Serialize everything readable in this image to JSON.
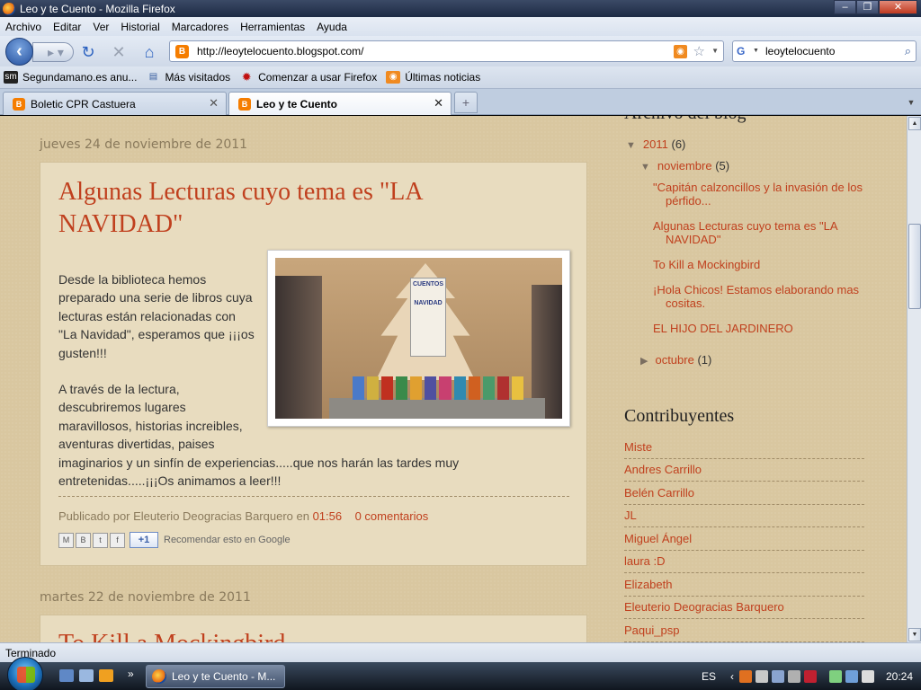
{
  "window": {
    "title": "Leo y te Cuento - Mozilla Firefox"
  },
  "menu": [
    "Archivo",
    "Editar",
    "Ver",
    "Historial",
    "Marcadores",
    "Herramientas",
    "Ayuda"
  ],
  "nav": {
    "url": "http://leoytelocuento.blogspot.com/",
    "search_value": "leoytelocuento"
  },
  "bookmarks": [
    "Segundamano.es anu...",
    "Más visitados",
    "Comenzar a usar Firefox",
    "Últimas noticias"
  ],
  "tabs": [
    {
      "label": "Boletic CPR Castuera",
      "active": false
    },
    {
      "label": "Leo y te Cuento",
      "active": true
    }
  ],
  "blog": {
    "post1": {
      "date": "jueves 24 de noviembre de 2011",
      "title_line1": "Algunas Lecturas cuyo tema es \"LA",
      "title_line2": "NAVIDAD\"",
      "para1_lines": [
        "Desde la biblioteca hemos",
        "preparado una serie de libros cuya",
        "lecturas están relacionadas con",
        "\"La Navidad\", esperamos que ¡¡¡os",
        "gusten!!!"
      ],
      "para2_lines": [
        "A través de la lectura,",
        "descubriremos lugares",
        "maravillosos, historias increibles,",
        "aventuras divertidas, paises",
        "imaginarios y un sinfín de experiencias.....que nos harán las tardes muy",
        "entretenidas.....¡¡¡Os animamos a leer!!!"
      ],
      "footer_prefix": "Publicado por Eleuterio Deogracias Barquero en",
      "footer_time": "01:56",
      "footer_comments": "0 comentarios",
      "plus_one": "+1",
      "recommend": "Recomendar esto en Google"
    },
    "post2": {
      "date": "martes 22 de noviembre de 2011",
      "title": "To Kill a Mockingbird"
    }
  },
  "sidebar": {
    "archive_heading": "Archivo del blog",
    "year": {
      "label": "2011",
      "count": "(6)"
    },
    "month": {
      "label": "noviembre",
      "count": "(5)"
    },
    "posts": [
      "\"Capitán calzoncillos y la invasión de los pérfido...",
      "Algunas Lecturas cuyo tema es \"LA NAVIDAD\"",
      "To Kill a Mockingbird",
      "¡Hola Chicos! Estamos elaborando mas cositas.",
      "EL HIJO DEL JARDINERO"
    ],
    "month2": {
      "label": "octubre",
      "count": "(1)"
    },
    "contrib_heading": "Contribuyentes",
    "contributors": [
      "Miste",
      "Andres Carrillo",
      "Belén Carrillo",
      "JL",
      "Miguel Ángel",
      "laura :D",
      "Elizabeth",
      "Eleuterio Deogracias Barquero",
      "Paqui_psp"
    ]
  },
  "status": {
    "text": "Terminado"
  },
  "taskbar": {
    "task_label": "Leo y te Cuento - M...",
    "lang": "ES",
    "clock": "20:24"
  }
}
